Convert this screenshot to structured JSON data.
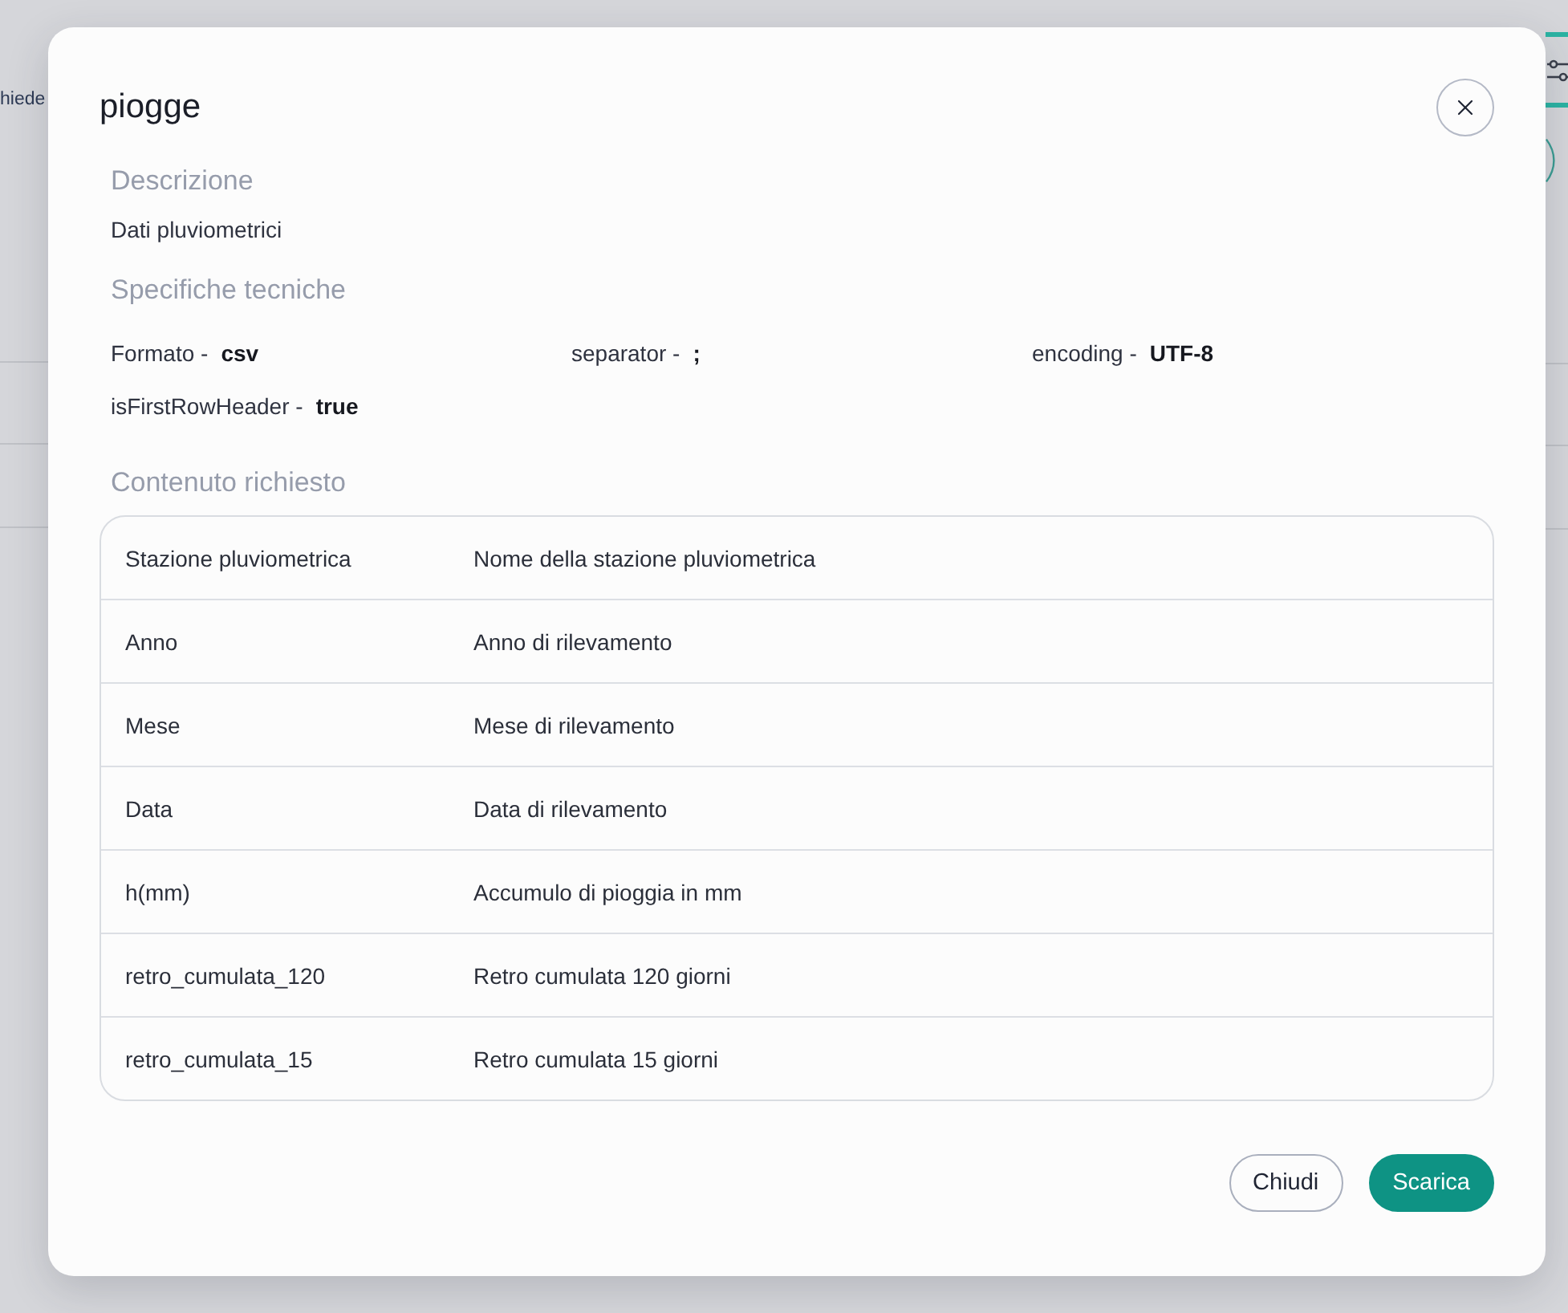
{
  "background_page": {
    "partial_text": "hiede"
  },
  "dialog": {
    "title": "piogge",
    "description": {
      "heading": "Descrizione",
      "text": "Dati pluviometrici"
    },
    "specs": {
      "heading": "Specifiche tecniche",
      "items": [
        {
          "label": "Formato -",
          "value": "csv"
        },
        {
          "label": "separator -",
          "value": ";"
        },
        {
          "label": "encoding -",
          "value": "UTF-8"
        },
        {
          "label": "isFirstRowHeader -",
          "value": "true"
        }
      ]
    },
    "content": {
      "heading": "Contenuto richiesto",
      "rows": [
        {
          "field": "Stazione pluviometrica",
          "description": "Nome della stazione pluviometrica"
        },
        {
          "field": "Anno",
          "description": "Anno di rilevamento"
        },
        {
          "field": "Mese",
          "description": "Mese di rilevamento"
        },
        {
          "field": "Data",
          "description": "Data di rilevamento"
        },
        {
          "field": "h(mm)",
          "description": "Accumulo di pioggia in mm"
        },
        {
          "field": "retro_cumulata_120",
          "description": "Retro cumulata 120 giorni"
        },
        {
          "field": "retro_cumulata_15",
          "description": "Retro cumulata 15 giorni"
        }
      ]
    },
    "buttons": [
      {
        "label": "Chiudi",
        "kind": "secondary"
      },
      {
        "label": "Scarica",
        "kind": "primary"
      }
    ]
  }
}
